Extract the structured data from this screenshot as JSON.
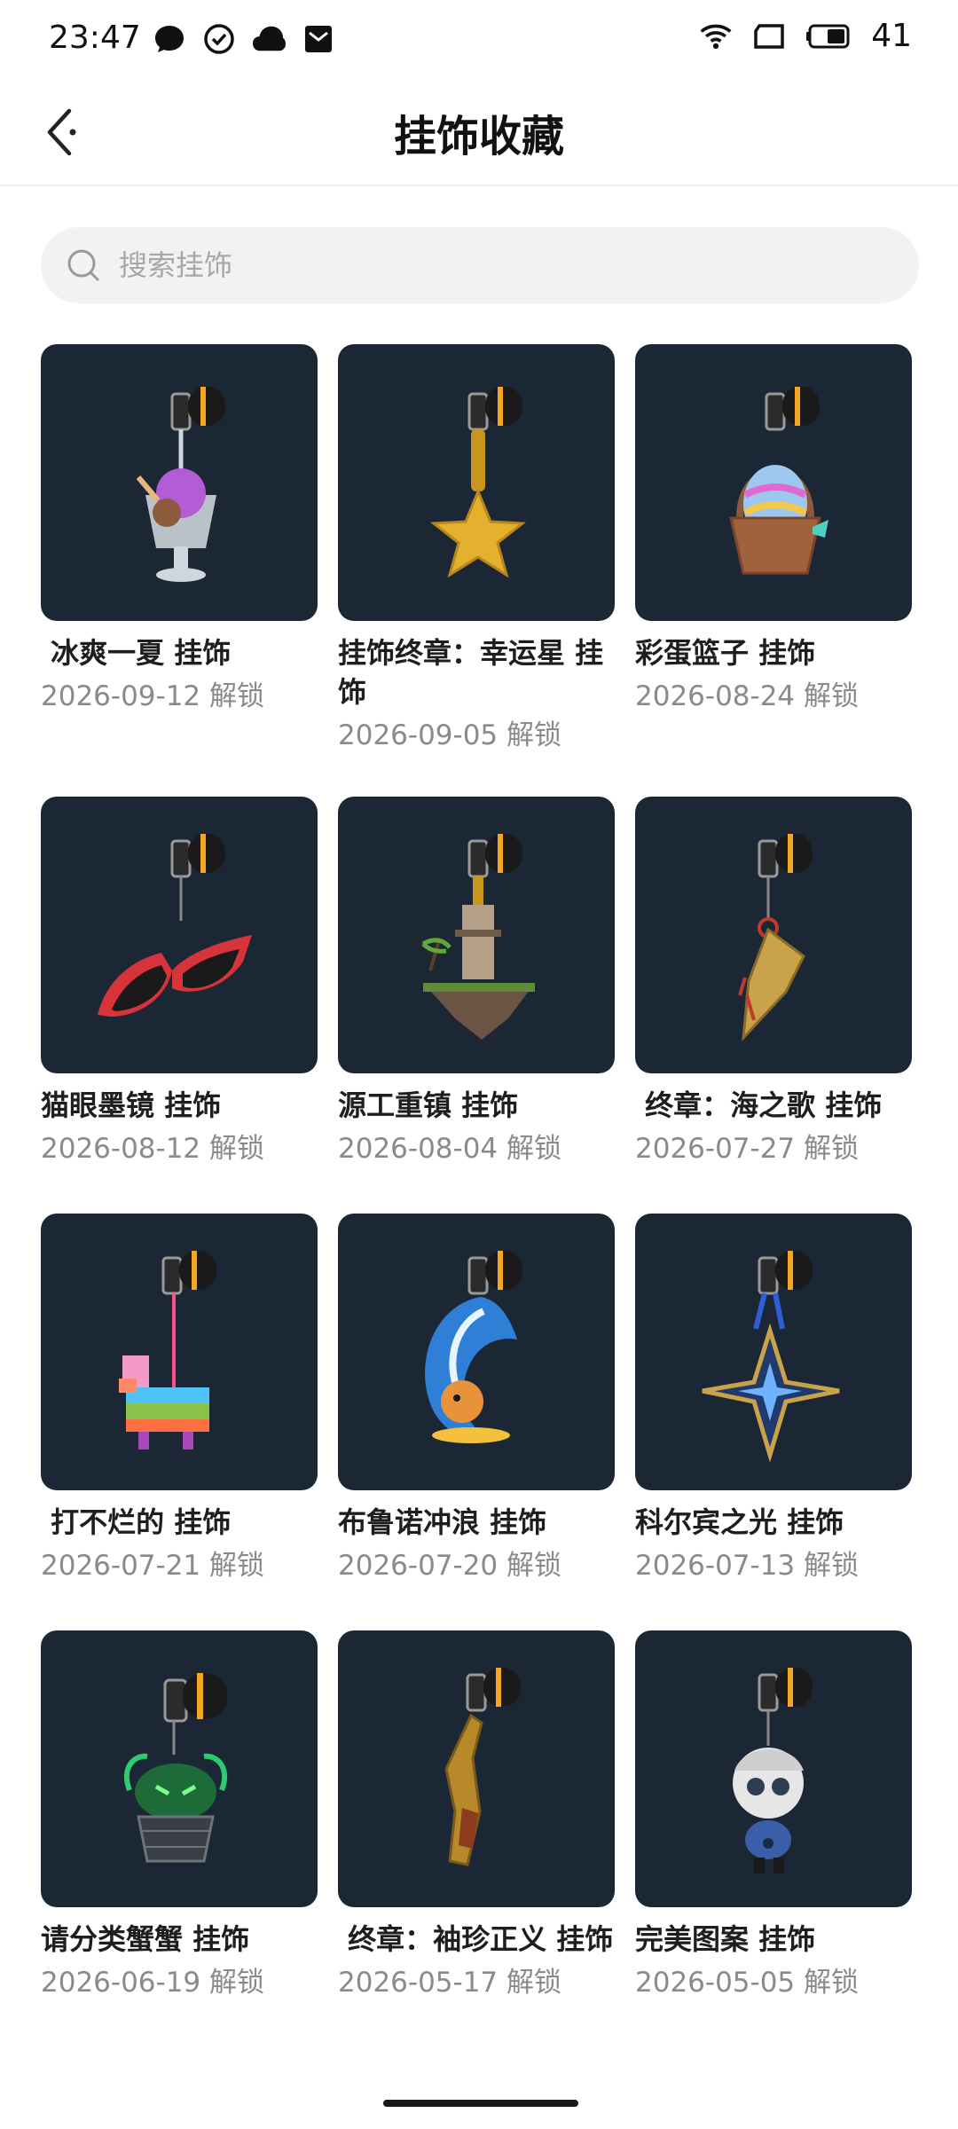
{
  "status": {
    "time": "23:47",
    "battery": "41",
    "left_icons": [
      "chat-bubble-icon",
      "check-circle-icon",
      "cloud-icon",
      "mail-icon"
    ],
    "right_icons": [
      "wifi-icon",
      "screen-icon",
      "battery-icon"
    ]
  },
  "header": {
    "title": "挂饰收藏",
    "back_icon": "chevron-left-icon"
  },
  "search": {
    "placeholder": "搜索挂饰",
    "value": ""
  },
  "colors": {
    "thumb_bg": "#1c2736",
    "accent": "#f5a623"
  },
  "items": [
    {
      "title": " 冰爽一夏 挂饰",
      "date": "2026-09-12 解锁",
      "icon": "ice-dessert-charm"
    },
    {
      "title": "挂饰终章：幸运星 挂饰",
      "date": "2026-09-05 解锁",
      "icon": "star-charm"
    },
    {
      "title": "彩蛋篮子 挂饰",
      "date": "2026-08-24 解锁",
      "icon": "egg-basket-charm"
    },
    {
      "title": "猫眼墨镜 挂饰",
      "date": "2026-08-12 解锁",
      "icon": "cat-eye-sunglasses-charm"
    },
    {
      "title": "源工重镇 挂饰",
      "date": "2026-08-04 解锁",
      "icon": "floating-island-charm"
    },
    {
      "title": " 终章：海之歌 挂饰",
      "date": "2026-07-27 解锁",
      "icon": "seashell-charm"
    },
    {
      "title": " 打不烂的 挂饰",
      "date": "2026-07-21 解锁",
      "icon": "pinata-charm"
    },
    {
      "title": "布鲁诺冲浪 挂饰",
      "date": "2026-07-20 解锁",
      "icon": "surfing-corgi-charm"
    },
    {
      "title": "科尔宾之光 挂饰",
      "date": "2026-07-13 解锁",
      "icon": "star-emblem-charm"
    },
    {
      "title": "请分类蟹蟹 挂饰",
      "date": "2026-06-19 解锁",
      "icon": "crab-bucket-charm"
    },
    {
      "title": " 终章：袖珍正义 挂饰",
      "date": "2026-05-17 解锁",
      "icon": "golden-gun-charm"
    },
    {
      "title": "完美图案 挂饰",
      "date": "2026-05-05 解锁",
      "icon": "robot-doll-charm"
    }
  ]
}
